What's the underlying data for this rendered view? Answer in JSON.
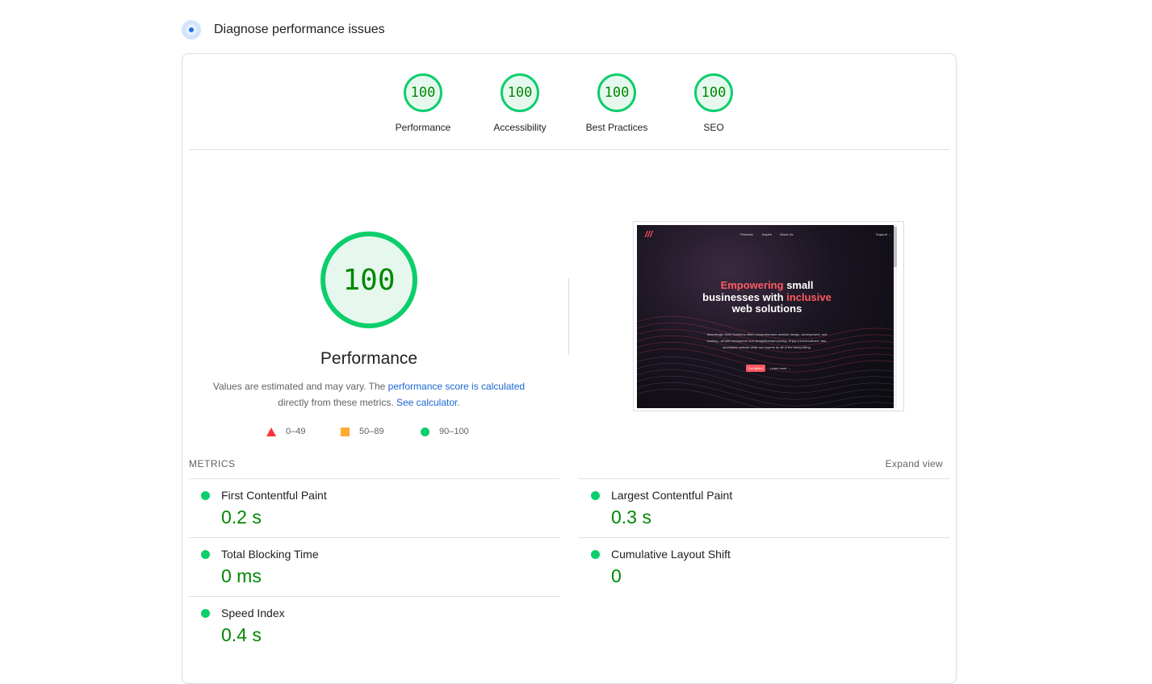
{
  "header": {
    "title": "Diagnose performance issues",
    "icon": "lighthouse-icon"
  },
  "scores": [
    {
      "value": "100",
      "label": "Performance"
    },
    {
      "value": "100",
      "label": "Accessibility"
    },
    {
      "value": "100",
      "label": "Best Practices"
    },
    {
      "value": "100",
      "label": "SEO"
    }
  ],
  "performance": {
    "score": "100",
    "title": "Performance",
    "desc_prefix": "Values are estimated and may vary. The ",
    "desc_link1": "performance score is calculated",
    "desc_middle": "directly from these metrics. ",
    "desc_link2": "See calculator",
    "desc_suffix": "."
  },
  "legend": [
    {
      "range": "0–49",
      "color": "#ff3333",
      "shape": "triangle"
    },
    {
      "range": "50–89",
      "color": "#ffaa33",
      "shape": "square"
    },
    {
      "range": "90–100",
      "color": "#0cce6b",
      "shape": "circle"
    }
  ],
  "screenshot": {
    "nav": [
      "Products",
      "Inspire",
      "About Us",
      "Support →"
    ],
    "heading_hl1": "Empowering",
    "heading_1": " small businesses with ",
    "heading_hl2": "inclusive",
    "heading_2": " web solutions",
    "body": "Wavelength Web Solutions offers comprehensive website design, development, and hosting—all with transparent and straightforward pricing. Enjoy a hand-tailored, fast, accessible website while our experts do all of the heavy lifting.",
    "button": "Get started",
    "link": "Learn more →"
  },
  "metrics": {
    "title": "METRICS",
    "expand": "Expand view",
    "items": [
      {
        "name": "First Contentful Paint",
        "value": "0.2 s"
      },
      {
        "name": "Largest Contentful Paint",
        "value": "0.3 s"
      },
      {
        "name": "Total Blocking Time",
        "value": "0 ms"
      },
      {
        "name": "Cumulative Layout Shift",
        "value": "0"
      },
      {
        "name": "Speed Index",
        "value": "0.4 s"
      }
    ]
  },
  "colors": {
    "pass": "#0cce6b",
    "pass_text": "#008800",
    "average": "#ffaa33",
    "fail": "#ff3333",
    "link": "#1967d2"
  }
}
